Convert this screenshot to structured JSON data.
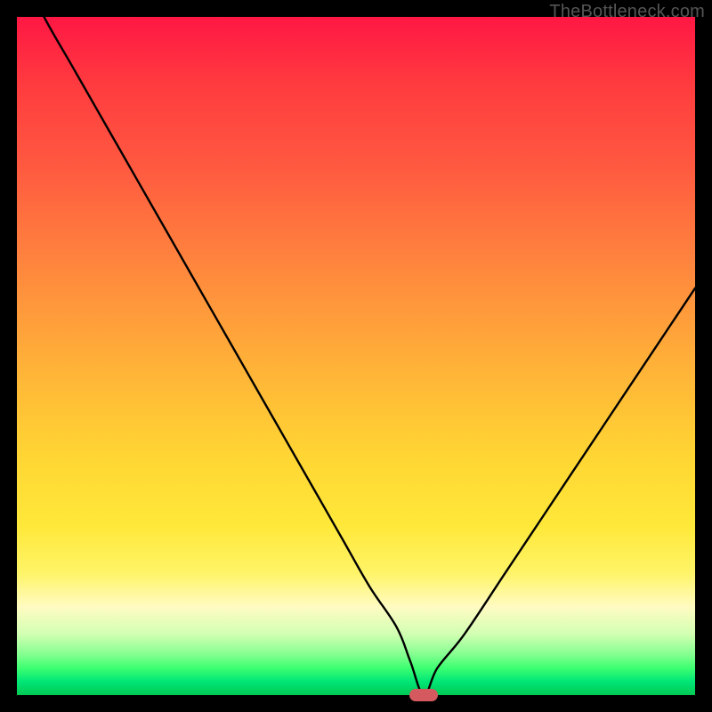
{
  "watermark": "TheBottleneck.com",
  "chart_data": {
    "type": "line",
    "title": "",
    "xlabel": "",
    "ylabel": "",
    "xlim": [
      0,
      100
    ],
    "ylim": [
      0,
      100
    ],
    "series": [
      {
        "name": "bottleneck-curve",
        "x": [
          0,
          4,
          8,
          12,
          16,
          20,
          24,
          28,
          32,
          36,
          40,
          44,
          48,
          52,
          56,
          58,
          60,
          62,
          66,
          72,
          78,
          84,
          90,
          96,
          100
        ],
        "values": [
          108,
          100,
          93,
          86,
          79,
          72,
          65,
          58,
          51,
          44,
          37,
          30,
          23,
          16,
          10,
          5,
          0,
          4,
          9,
          18,
          27,
          36,
          45,
          54,
          60
        ]
      }
    ],
    "marker": {
      "x": 60,
      "y": 0,
      "color": "#d45a5f"
    },
    "background_gradient": {
      "top": "#ff1744",
      "bottom": "#00c853"
    }
  }
}
